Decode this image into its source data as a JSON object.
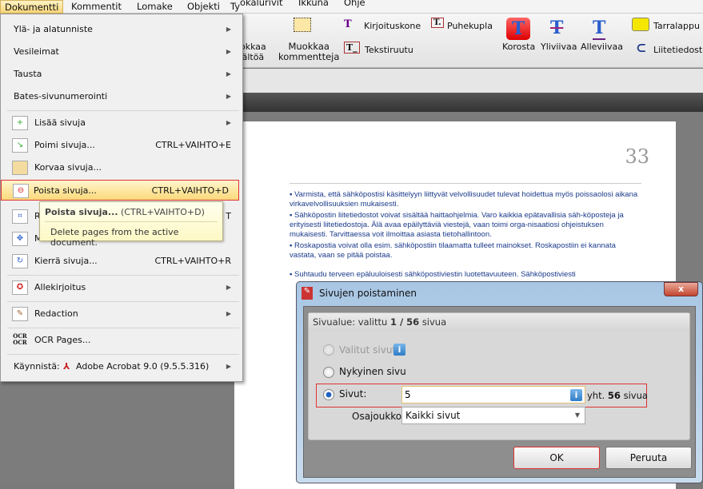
{
  "menubar": {
    "items": [
      "Dokumentti",
      "Kommentit",
      "Lomake",
      "Objekti",
      "Ty",
      "ökalurivit",
      "Ikkuna",
      "Ohje"
    ]
  },
  "toolbar": {
    "muokkaa_sisaltoa": [
      "okkaa",
      "ältöä"
    ],
    "muokkaa_kommentteja": [
      "Muokkaa",
      "kommentteja"
    ],
    "kirjoituskone": "Kirjoituskone",
    "puhekupla": "Puhekupla",
    "tekstiruutu": "Tekstiruutu",
    "korosta": "Korosta",
    "yliviivaa": "Yliviivaa",
    "alleviivaa": "Alleviivaa",
    "tarralappu": "Tarralappu",
    "liitetiedosto": "Liitetiedosto"
  },
  "menu": {
    "items": [
      {
        "label": "Ylä- ja alatunniste",
        "submenu": true
      },
      {
        "label": "Vesileimat",
        "submenu": true
      },
      {
        "label": "Tausta",
        "submenu": true
      },
      {
        "label": "Bates-sivunumerointi",
        "submenu": true
      },
      {
        "label": "Lisää sivuja",
        "submenu": true
      },
      {
        "label": "Poimi sivuja...",
        "shortcut": "CTRL+VAIHTO+E"
      },
      {
        "label": "Korvaa sivuja..."
      },
      {
        "label": "Poista sivuja...",
        "shortcut": "CTRL+VAIHTO+D"
      },
      {
        "label": "R",
        "shortcut": "T"
      },
      {
        "label": "M"
      },
      {
        "label": "Kierrä sivuja...",
        "shortcut": "CTRL+VAIHTO+R"
      },
      {
        "label": "Allekirjoitus",
        "submenu": true
      },
      {
        "label": "Redaction",
        "submenu": true
      },
      {
        "label": "OCR Pages..."
      },
      {
        "label": "Käynnistä:",
        "app": "Adobe Acrobat 9.0 (9.5.5.316)",
        "submenu": true
      }
    ]
  },
  "tooltip": {
    "title": "Poista sivuja...",
    "shortcut": "(CTRL+VAIHTO+D)",
    "description": "Delete pages from the active document."
  },
  "document": {
    "page_number": "33",
    "bullets": [
      "Varmista, että sähköpostisi käsittelyyn liittyvät velvollisuudet tulevat hoidettua myös poissaolosi aikana virkavelvollisuuksien mukaisesti.",
      "Sähköpostin liitetiedostot voivat sisältää haittaohjelmia. Varo kaikkia epätavallisia säh-köposteja ja erityisesti liitetiedostoja. Älä avaa epäilyttäviä viestejä, vaan toimi orga-nisaatiosi ohjeistuksen mukaisesti. Tarvittaessa voit ilmoittaa asiasta tietohallintoon.",
      "Roskapostia voivat olla esim. sähköpostiin tilaamatta tulleet mainokset. Roskapostiin ei kannata vastata, vaan se pitää poistaa.",
      "Suhtaudu terveen epäluuloisesti sähköpostiviestin luotettavuuteen. Sähköpostiviesti"
    ]
  },
  "dialog": {
    "title": "Sivujen poistaminen",
    "range_prefix": "Sivualue: valittu",
    "range_selected": "1 / 56",
    "range_suffix": "sivua",
    "option_selected_pages": "Valitut sivut",
    "option_current_page": "Nykyinen sivu",
    "option_pages": "Sivut:",
    "pages_value": "5",
    "total_prefix": "yht.",
    "total_count": "56",
    "total_suffix": "sivua",
    "subset_label": "Osajoukko:",
    "subset_value": "Kaikki sivut",
    "ok": "OK",
    "cancel": "Peruuta",
    "close": "x"
  }
}
